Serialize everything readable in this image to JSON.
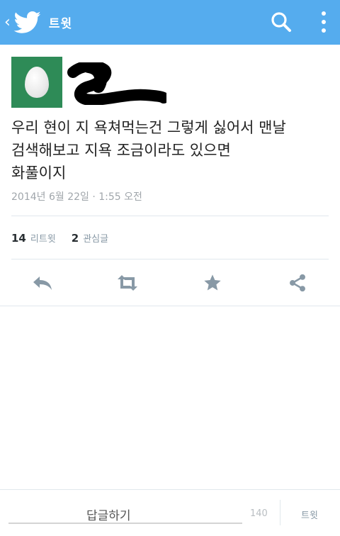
{
  "header": {
    "title": "트윗",
    "colors": {
      "bar": "#55acee",
      "icon": "#ffffff"
    },
    "icons": [
      "chevron-left-icon",
      "twitter-bird-icon",
      "search-icon",
      "overflow-menu-icon"
    ]
  },
  "tweet": {
    "text_lines": [
      "우리 현이 지 욕쳐먹는건 그렇게 싫어서 맨날",
      "검색해보고 지욕 조금이라도 있으면",
      "화풀이지"
    ],
    "timestamp": "2014년 6월 22일 · 1:55 오전",
    "retweets": {
      "count": "14",
      "label": "리트윗"
    },
    "favorites": {
      "count": "2",
      "label": "관심글"
    }
  },
  "actions": [
    "reply-icon",
    "retweet-icon",
    "favorite-icon",
    "share-icon"
  ],
  "reply": {
    "placeholder": "답글하기",
    "char_count": "140",
    "tweet_button": "트윗"
  }
}
